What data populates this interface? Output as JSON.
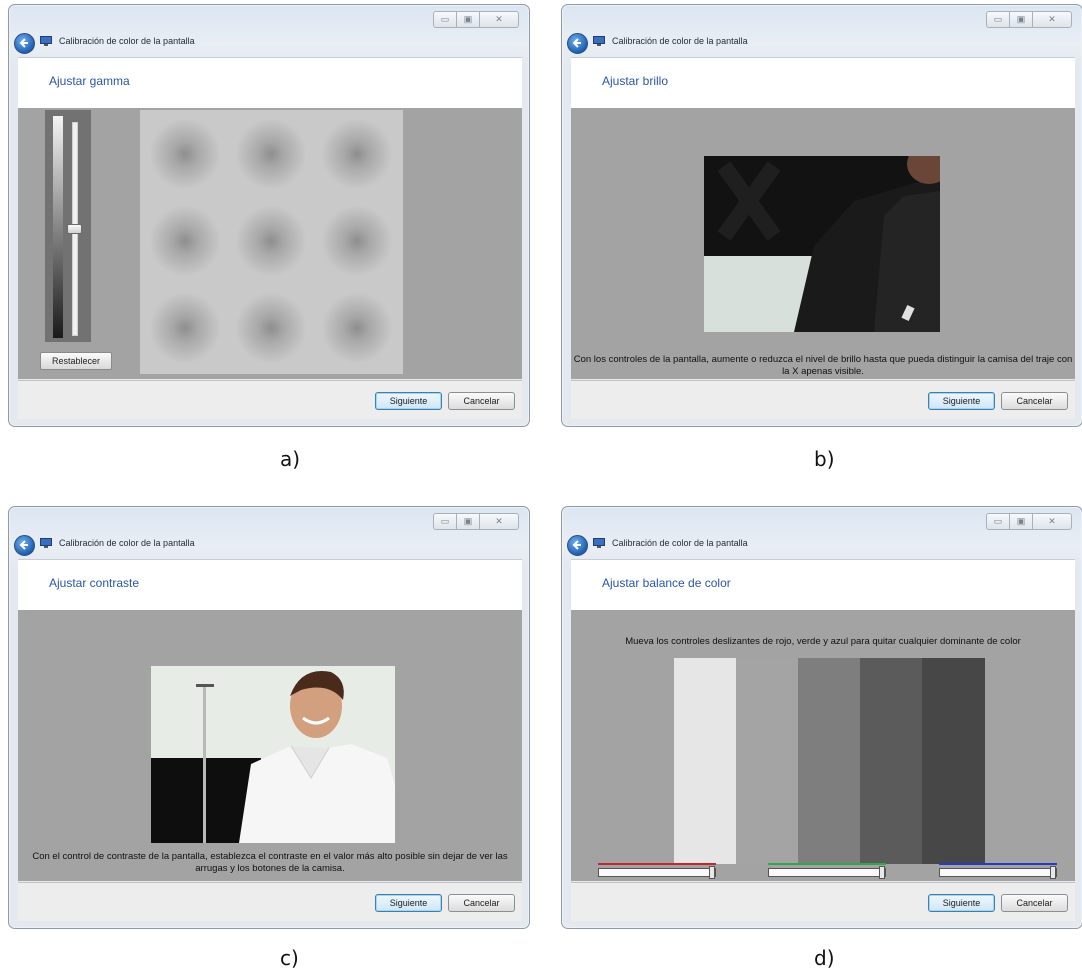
{
  "window_title": "Calibración de color de la pantalla",
  "buttons": {
    "next": "Siguiente",
    "cancel": "Cancelar",
    "reset": "Restablecer"
  },
  "panels": {
    "a": {
      "caption": "a)",
      "heading": "Ajustar gamma"
    },
    "b": {
      "caption": "b)",
      "heading": "Ajustar brillo",
      "description": "Con los controles de la pantalla, aumente o reduzca el nivel de brillo hasta que pueda distinguir la camisa del traje con la X apenas visible."
    },
    "c": {
      "caption": "c)",
      "heading": "Ajustar contraste",
      "description": "Con el control de contraste de la pantalla, establezca el contraste en el valor más alto posible sin dejar de ver las arrugas y los botones de la camisa."
    },
    "d": {
      "caption": "d)",
      "heading": "Ajustar balance de color",
      "description": "Mueva los controles deslizantes de rojo, verde y azul para quitar cualquier dominante de color",
      "slider_colors": [
        "#c0282c",
        "#2fa84a",
        "#2a3ac0"
      ],
      "bar_colors": [
        "#e6e6e6",
        "#a4a4a4",
        "#7e7e7e",
        "#5b5b5b",
        "#474747"
      ]
    }
  },
  "icons": {
    "back": "back-arrow-icon",
    "app": "display-icon",
    "minimize": "minimize-icon",
    "maximize": "maximize-icon",
    "close": "close-icon"
  }
}
